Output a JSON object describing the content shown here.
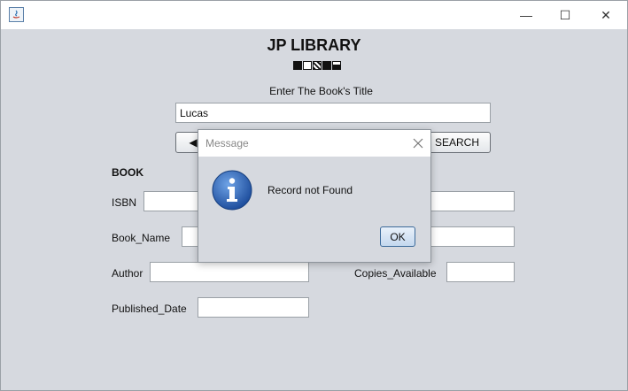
{
  "window": {
    "minimize_glyph": "—",
    "maximize_glyph": "☐",
    "close_glyph": "✕"
  },
  "header": {
    "title": "JP LIBRARY"
  },
  "search": {
    "prompt": "Enter The Book's Title",
    "value": "Lucas",
    "back_label": "◀",
    "search_label": "SEARCH"
  },
  "book": {
    "section_label": "BOOK",
    "fields": {
      "isbn": {
        "label": "ISBN",
        "value": ""
      },
      "book_name": {
        "label": "Book_Name",
        "value": ""
      },
      "author": {
        "label": "Author",
        "value": ""
      },
      "copies_available": {
        "label": "Copies_Available",
        "value": ""
      },
      "published_date": {
        "label": "Published_Date",
        "value": ""
      }
    }
  },
  "dialog": {
    "title": "Message",
    "message": "Record not Found",
    "ok_label": "OK",
    "icon": "info-icon",
    "close_glyph": "✕"
  },
  "colors": {
    "window_bg": "#d6d9df",
    "info_blue": "#2a63b8"
  }
}
